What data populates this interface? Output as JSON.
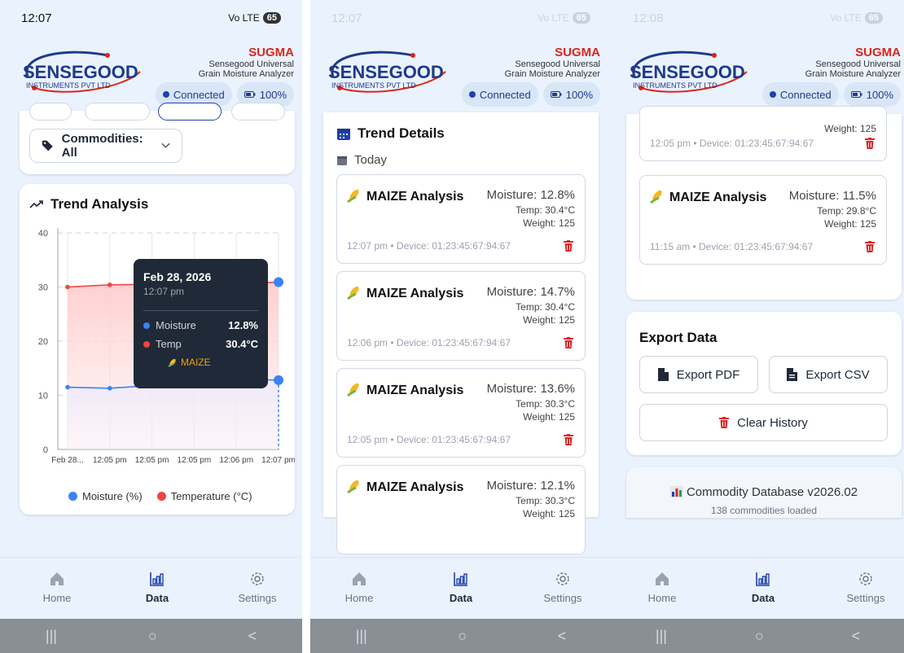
{
  "status": {
    "s1_time": "12:07",
    "s2_time": "12:07",
    "s3_time": "12:08",
    "signal": "Vo LTE",
    "battery": "65"
  },
  "header": {
    "logo_top": "SENSEGOOD",
    "logo_bottom": "INSTRUMENTS PVT LTD",
    "brand": "SUGMA",
    "brand_sub1": "Sensegood Universal",
    "brand_sub2": "Grain Moisture Analyzer",
    "connected": "Connected",
    "battery": "100%"
  },
  "filters": {
    "commodities": "Commodities: All"
  },
  "trend": {
    "title": "Trend Analysis",
    "tooltip": {
      "date": "Feb 28, 2026",
      "time": "12:07 pm",
      "moisture_label": "Moisture",
      "moisture_value": "12.8%",
      "temp_label": "Temp",
      "temp_value": "30.4°C",
      "commodity": "MAIZE"
    },
    "legend_moisture": "Moisture (%)",
    "legend_temp": "Temperature (°C)"
  },
  "chart_data": {
    "type": "line",
    "categories": [
      "Feb 28...",
      "12:05 pm",
      "12:05 pm",
      "12:05 pm",
      "12:06 pm",
      "12:07 pm"
    ],
    "series": [
      {
        "name": "Moisture (%)",
        "values": [
          11.5,
          11.3,
          11.8,
          12.4,
          13.0,
          12.8
        ]
      },
      {
        "name": "Temperature (°C)",
        "values": [
          30.0,
          30.4,
          30.5,
          30.6,
          30.6,
          30.9
        ]
      }
    ],
    "ylim": [
      0,
      40
    ],
    "yticks": [
      "0",
      "10",
      "20",
      "30",
      "40"
    ],
    "colors": [
      "#3b82f6",
      "#ef4444"
    ],
    "grid": true,
    "legend": "bottom"
  },
  "details": {
    "title": "Trend Details",
    "day": "Today"
  },
  "records": [
    {
      "title": "MAIZE Analysis",
      "moisture": "Moisture: 12.8%",
      "temp": "Temp: 30.4°C",
      "weight": "Weight: 125",
      "foot": "12:07 pm • Device: 01:23:45:67:94:67"
    },
    {
      "title": "MAIZE Analysis",
      "moisture": "Moisture: 14.7%",
      "temp": "Temp: 30.4°C",
      "weight": "Weight: 125",
      "foot": "12:06 pm • Device: 01:23:45:67:94:67"
    },
    {
      "title": "MAIZE Analysis",
      "moisture": "Moisture: 13.6%",
      "temp": "Temp: 30.3°C",
      "weight": "Weight: 125",
      "foot": "12:05 pm • Device: 01:23:45:67:94:67"
    },
    {
      "title": "MAIZE Analysis",
      "moisture": "Moisture: 12.1%",
      "temp": "Temp: 30.3°C",
      "weight": "Weight: 125",
      "foot": ""
    }
  ],
  "records3": [
    {
      "weight": "Weight: 125",
      "foot": "12:05 pm • Device: 01:23:45:67:94:67"
    },
    {
      "title": "MAIZE Analysis",
      "moisture": "Moisture: 11.5%",
      "temp": "Temp: 29.8°C",
      "weight": "Weight: 125",
      "foot": "11:15 am • Device: 01:23:45:67:94:67"
    }
  ],
  "export": {
    "title": "Export Data",
    "pdf": "Export PDF",
    "csv": "Export CSV",
    "clear": "Clear History"
  },
  "db": {
    "title": "Commodity Database v2026.02",
    "count": "138 commodities loaded"
  },
  "nav": {
    "home": "Home",
    "data": "Data",
    "settings": "Settings"
  },
  "sysnav": {
    "recents": "|||",
    "home": "○",
    "back": "<"
  }
}
